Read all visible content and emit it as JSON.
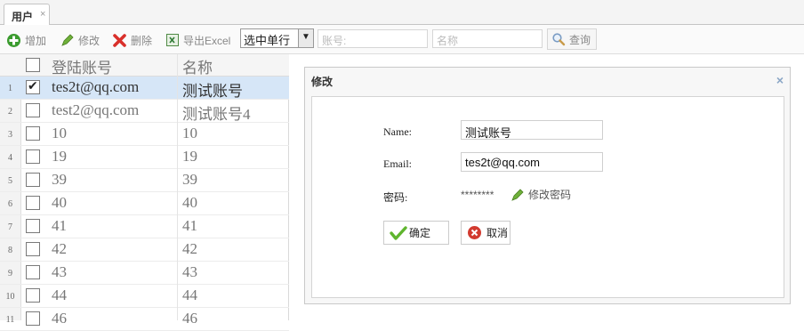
{
  "tabs": [
    {
      "label": "用户",
      "close": "×"
    }
  ],
  "toolbar": {
    "add": "增加",
    "edit": "修改",
    "delete": "删除",
    "export": "导出Excel",
    "select_value": "选中单行",
    "select_arrow": "▼",
    "account_placeholder": "账号:",
    "name_placeholder": "名称",
    "search": "查询"
  },
  "grid": {
    "columns": [
      "登陆账号",
      "名称"
    ],
    "rows": [
      {
        "num": "1",
        "account": "tes2t@qq.com",
        "name": "测试账号",
        "checked": true,
        "check": "✔"
      },
      {
        "num": "2",
        "account": "test2@qq.com",
        "name": "测试账号4",
        "checked": false
      },
      {
        "num": "3",
        "account": "10",
        "name": "10",
        "checked": false
      },
      {
        "num": "4",
        "account": "19",
        "name": "19",
        "checked": false
      },
      {
        "num": "5",
        "account": "39",
        "name": "39",
        "checked": false
      },
      {
        "num": "6",
        "account": "40",
        "name": "40",
        "checked": false
      },
      {
        "num": "7",
        "account": "41",
        "name": "41",
        "checked": false
      },
      {
        "num": "8",
        "account": "42",
        "name": "42",
        "checked": false
      },
      {
        "num": "9",
        "account": "43",
        "name": "43",
        "checked": false
      },
      {
        "num": "10",
        "account": "44",
        "name": "44",
        "checked": false
      },
      {
        "num": "11",
        "account": "46",
        "name": "46",
        "checked": false
      }
    ]
  },
  "dialog": {
    "title": "修改",
    "close": "×",
    "name_label": "Name:",
    "name_value": "测试账号",
    "email_label": "Email:",
    "email_value": "tes2t@qq.com",
    "password_label": "密码:",
    "password_mask": "********",
    "change_password": "修改密码",
    "ok": "确定",
    "cancel": "取消"
  },
  "colors": {
    "selected_row": "#d6e6f7",
    "add_icon": "#3a9b2e",
    "delete_icon": "#d9302b",
    "edit_icon": "#5aa02c"
  }
}
